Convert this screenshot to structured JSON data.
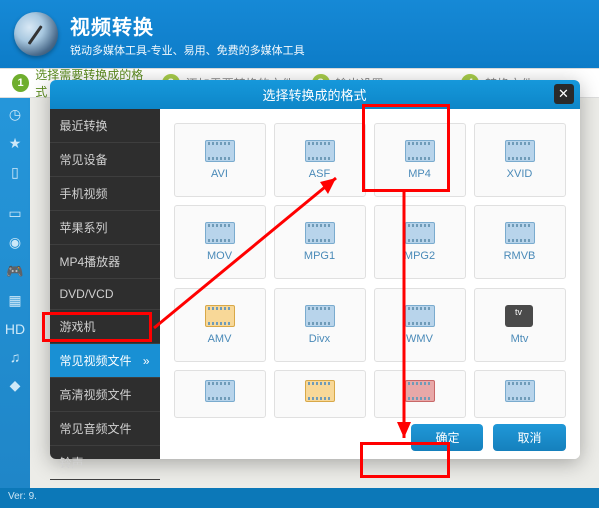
{
  "header": {
    "title": "视频转换",
    "subtitle": "锐动多媒体工具-专业、易用、免费的多媒体工具"
  },
  "steps": {
    "s1": {
      "num": "1",
      "label": "选择需要转换成的格式"
    },
    "s2": {
      "num": "2",
      "label": "添加需要转换的文件"
    },
    "s3": {
      "num": "3",
      "label": "输出设置"
    },
    "s4": {
      "num": "4",
      "label": "转换文件"
    }
  },
  "modal": {
    "title": "选择转换成的格式",
    "sidebar": {
      "items": [
        "最近转换",
        "常见设备",
        "手机视频",
        "苹果系列",
        "MP4播放器",
        "DVD/VCD",
        "游戏机",
        "常见视频文件",
        "高清视频文件",
        "常见音频文件",
        "铃声"
      ]
    },
    "formats": {
      "r1": [
        "AVI",
        "ASF",
        "MP4",
        "XVID"
      ],
      "r2": [
        "MOV",
        "MPG1",
        "MPG2",
        "RMVB"
      ],
      "r3": [
        "AMV",
        "Divx",
        "WMV",
        "Mtv"
      ],
      "r4": [
        "",
        "",
        "",
        ""
      ]
    },
    "actions": {
      "ok": "确定",
      "cancel": "取消"
    }
  },
  "chart_data": {
    "type": "table"
  },
  "footer": {
    "version": "Ver: 9."
  }
}
